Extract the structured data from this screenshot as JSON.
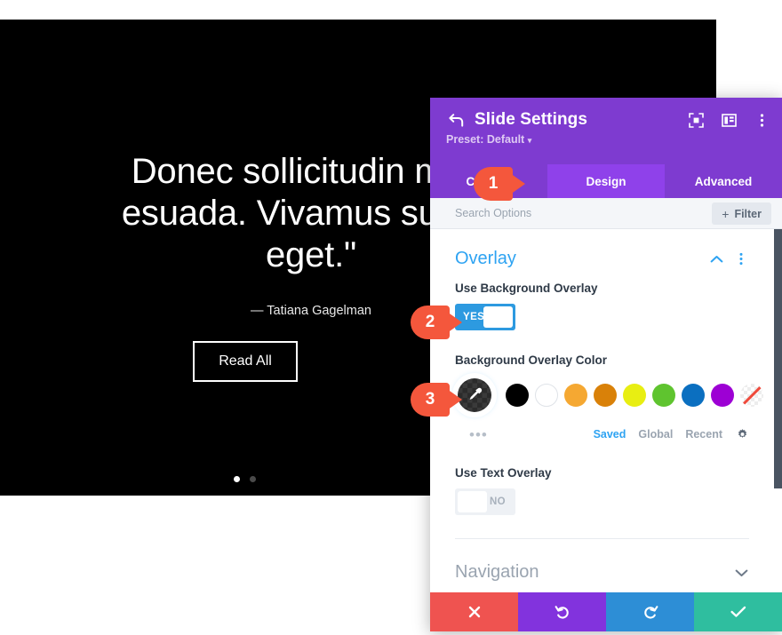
{
  "slider": {
    "quote_lines": [
      "Donec sollicitudin mole",
      "esuada. Vivamus suscip",
      "eget.\""
    ],
    "author": "— Tatiana Gagelman",
    "button_label": "Read All",
    "dots": [
      {
        "active": true
      },
      {
        "active": false
      }
    ],
    "background_color": "#000000"
  },
  "panel": {
    "title": "Slide Settings",
    "back_icon": "back-arrow-icon",
    "preset_label": "Preset: Default",
    "preset_caret": "▾",
    "header_icons": [
      {
        "name": "fullscreen-icon"
      },
      {
        "name": "layout-view-icon"
      },
      {
        "name": "more-vertical-icon"
      }
    ],
    "header_color": "#7e3bd0",
    "tabs": [
      {
        "label": "Content",
        "active": false
      },
      {
        "label": "Design",
        "active": true
      },
      {
        "label": "Advanced",
        "active": false
      }
    ],
    "active_tab_color": "#8f41ea",
    "search": {
      "placeholder": "Search Options",
      "value": "",
      "filter_label": "Filter",
      "filter_plus": "+"
    },
    "sections": [
      {
        "title": "Overlay",
        "expanded": true,
        "collapse_icon": "chevron-up-icon",
        "menu_icon": "more-vertical-icon"
      },
      {
        "title": "Navigation",
        "expanded": false,
        "collapse_icon": "chevron-down-icon"
      }
    ],
    "overlay": {
      "background_overlay": {
        "label": "Use Background Overlay",
        "toggle_value": "YES",
        "on": true,
        "on_color": "#2d9ae0"
      },
      "overlay_color": {
        "label": "Background Overlay Color",
        "picker_icon": "eyedropper-icon",
        "swatches": [
          {
            "name": "swatch-black",
            "color": "#000000"
          },
          {
            "name": "swatch-white",
            "color": "#ffffff"
          },
          {
            "name": "swatch-light-orange",
            "color": "#f5a832"
          },
          {
            "name": "swatch-dark-orange",
            "color": "#d98109"
          },
          {
            "name": "swatch-yellow",
            "color": "#e8ee12"
          },
          {
            "name": "swatch-green",
            "color": "#5fc42f"
          },
          {
            "name": "swatch-blue",
            "color": "#0b6fc0"
          },
          {
            "name": "swatch-purple",
            "color": "#9d00d4"
          },
          {
            "name": "swatch-none",
            "color": "none"
          }
        ],
        "more_dots": "•••",
        "tabs": [
          {
            "label": "Saved",
            "active": true
          },
          {
            "label": "Global",
            "active": false
          },
          {
            "label": "Recent",
            "active": false
          }
        ],
        "settings_icon": "gear-icon"
      },
      "text_overlay": {
        "label": "Use Text Overlay",
        "toggle_value": "NO",
        "on": false
      }
    },
    "footer_actions": [
      {
        "name": "cancel-button",
        "icon": "close-icon",
        "color": "#ef5350"
      },
      {
        "name": "undo-button",
        "icon": "undo-icon",
        "color": "#8233dd"
      },
      {
        "name": "redo-button",
        "icon": "redo-icon",
        "color": "#2d8ed6"
      },
      {
        "name": "save-button",
        "icon": "check-icon",
        "color": "#2fbe9f"
      }
    ]
  },
  "callouts": [
    {
      "number": "1",
      "color": "#f4573c"
    },
    {
      "number": "2",
      "color": "#f4573c"
    },
    {
      "number": "3",
      "color": "#f4573c"
    }
  ]
}
